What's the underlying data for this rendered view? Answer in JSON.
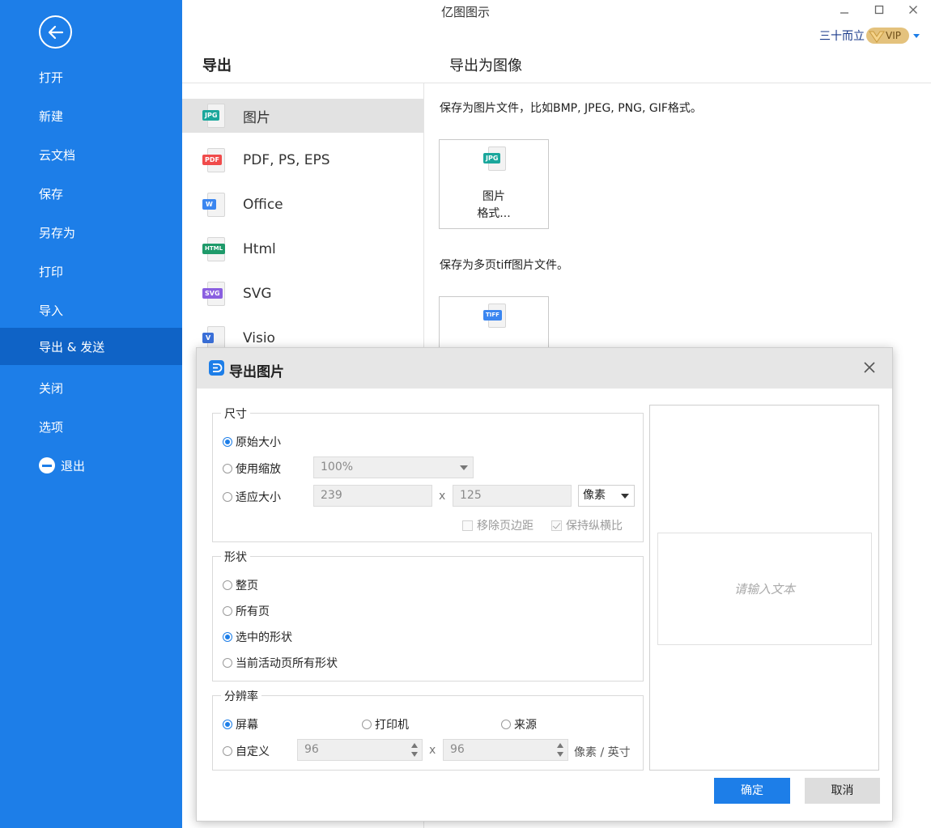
{
  "app": {
    "title": "亿图图示",
    "user_name": "三十而立",
    "vip_label": "VIP",
    "window_controls": [
      "minimize-icon",
      "maximize-icon",
      "close-icon"
    ]
  },
  "sidebar": {
    "items": [
      {
        "label": "打开"
      },
      {
        "label": "新建"
      },
      {
        "label": "云文档"
      },
      {
        "label": "保存"
      },
      {
        "label": "另存为"
      },
      {
        "label": "打印"
      },
      {
        "label": "导入"
      },
      {
        "label": "导出 & 发送",
        "active": true
      },
      {
        "label": "关闭"
      },
      {
        "label": "选项"
      },
      {
        "label": "退出",
        "icon": "exit-icon"
      }
    ]
  },
  "export": {
    "section_title": "导出",
    "panel_title": "导出为图像",
    "formats": [
      {
        "label": "图片",
        "tag": "JPG",
        "tag_color": "#1aa79c",
        "selected": true
      },
      {
        "label": "PDF, PS, EPS",
        "tag": "PDF",
        "tag_color": "#f04b4b"
      },
      {
        "label": "Office",
        "tag": "W",
        "tag_color": "#3b86f0"
      },
      {
        "label": "Html",
        "tag": "HTML",
        "tag_color": "#1e9a6a"
      },
      {
        "label": "SVG",
        "tag": "SVG",
        "tag_color": "#8a5fe0"
      },
      {
        "label": "Visio",
        "tag": "V",
        "tag_color": "#3a6fd8"
      }
    ],
    "image_desc": "保存为图片文件，比如BMP, JPEG, PNG, GIF格式。",
    "image_tile": {
      "line1": "图片",
      "line2": "格式...",
      "tag": "JPG"
    },
    "tiff_desc": "保存为多页tiff图片文件。",
    "tiff_tile": {
      "tag": "TIFF"
    }
  },
  "dialog": {
    "title": "导出图片",
    "size": {
      "legend": "尺寸",
      "original_label": "原始大小",
      "scale_label": "使用缩放",
      "scale_value": "100%",
      "fit_label": "适应大小",
      "width_value": "239",
      "height_value": "125",
      "unit_value": "像素",
      "x_sep": "x",
      "remove_margin_label": "移除页边距",
      "keep_ratio_label": "保持纵横比",
      "selected": "original"
    },
    "shape": {
      "legend": "形状",
      "options": [
        "整页",
        "所有页",
        "选中的形状",
        "当前活动页所有形状"
      ],
      "selected_index": 2
    },
    "resolution": {
      "legend": "分辨率",
      "screen_label": "屏幕",
      "printer_label": "打印机",
      "source_label": "来源",
      "custom_label": "自定义",
      "dpi_x": "96",
      "dpi_y": "96",
      "x_sep": "x",
      "unit_label": "像素 / 英寸",
      "selected": "screen"
    },
    "preview_placeholder": "请输入文本",
    "ok_label": "确定",
    "cancel_label": "取消"
  },
  "colors": {
    "sidebar": "#1d7ee8",
    "sidebar_active": "#0f63c6",
    "accent": "#1d7ee8"
  }
}
